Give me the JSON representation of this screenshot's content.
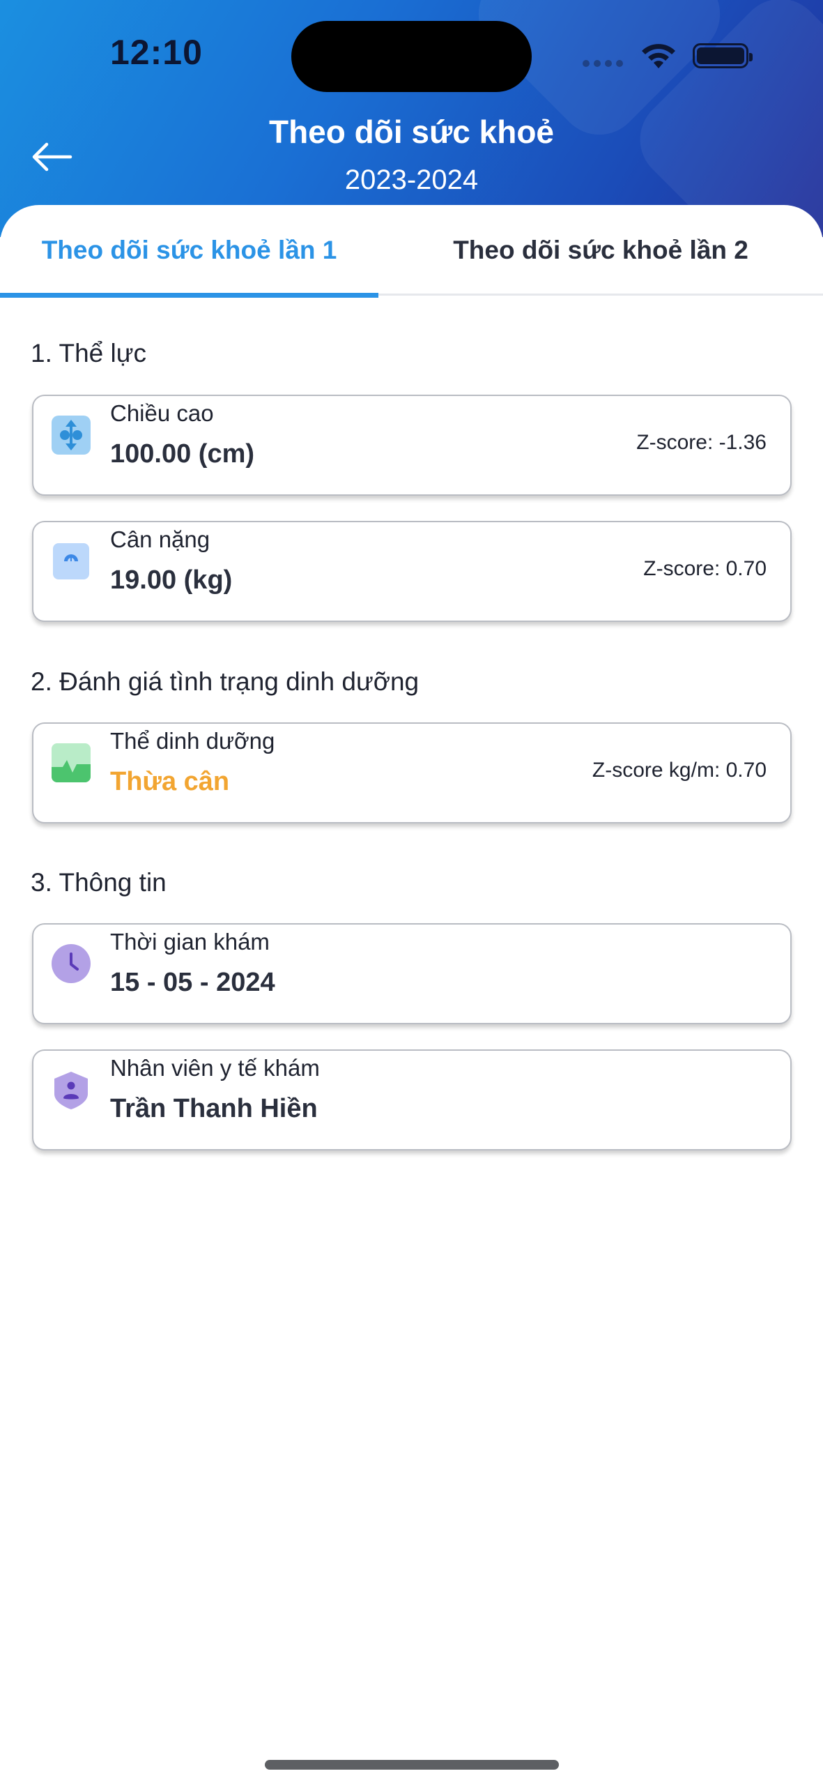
{
  "status_bar": {
    "time": "12:10"
  },
  "header": {
    "title": "Theo dõi sức khoẻ",
    "subtitle": "2023-2024"
  },
  "tabs": [
    {
      "label": "Theo dõi sức khoẻ lần 1",
      "active": true
    },
    {
      "label": "Theo dõi sức khoẻ lần 2",
      "active": false
    }
  ],
  "sections": {
    "physical": {
      "title": "1. Thể lực",
      "height": {
        "label": "Chiều cao",
        "value": "100.00 (cm)",
        "zscore": "Z-score: -1.36",
        "icon": "height-icon"
      },
      "weight": {
        "label": "Cân nặng",
        "value": "19.00 (kg)",
        "zscore": "Z-score: 0.70",
        "icon": "scale-icon"
      }
    },
    "nutrition": {
      "title": "2. Đánh giá tình trạng dinh dưỡng",
      "status": {
        "label": "Thể dinh dưỡng",
        "value": "Thừa cân",
        "zscore": "Z-score kg/m: 0.70",
        "icon": "nutrition-chart-icon",
        "value_color": "#f2a531"
      }
    },
    "info": {
      "title": "3. Thông tin",
      "exam_time": {
        "label": "Thời gian khám",
        "value": "15 - 05 - 2024",
        "icon": "clock-icon"
      },
      "staff": {
        "label": "Nhân viên y tế khám",
        "value": "Trần Thanh Hiền",
        "icon": "shield-user-icon"
      }
    }
  },
  "colors": {
    "accent": "#2b93e6",
    "header_gradient_start": "#1b8fe0",
    "header_gradient_end": "#22309a",
    "warning": "#f2a531"
  }
}
